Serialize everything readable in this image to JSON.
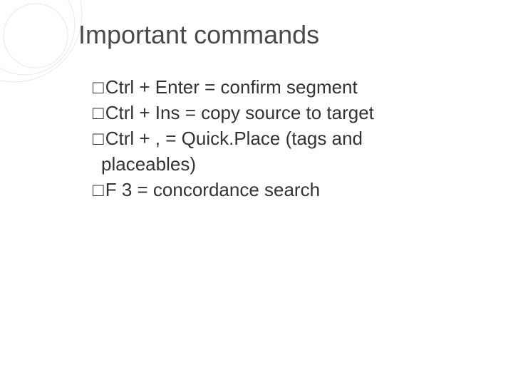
{
  "title": "Important commands",
  "bullets": {
    "b0": "Ctrl + Enter = confirm segment",
    "b1": "Ctrl + Ins = copy source to target",
    "b2": "Ctrl + , = Quick.Place (tags and",
    "b2_cont": "placeables)",
    "b3": "F 3 = concordance search"
  },
  "bullet_char": "□"
}
